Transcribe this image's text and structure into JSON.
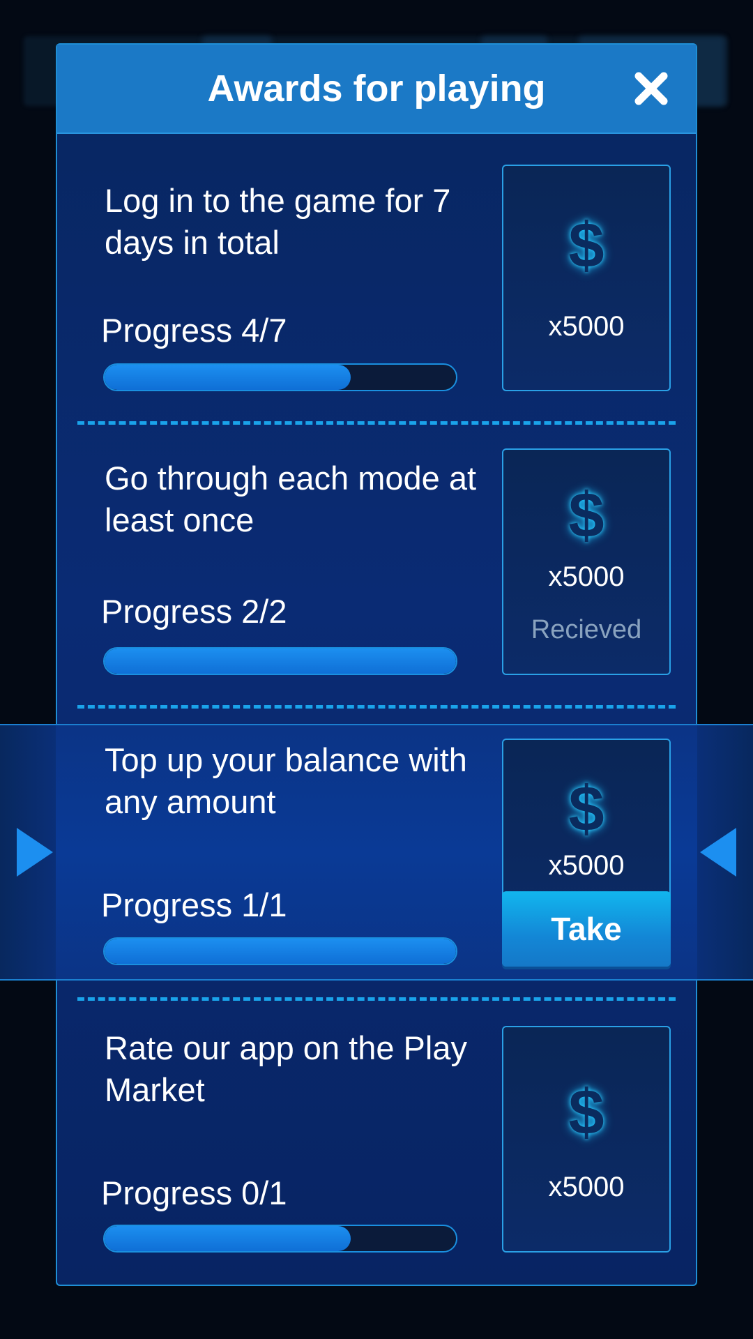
{
  "modal": {
    "title": "Awards for playing"
  },
  "tasks": [
    {
      "title": "Log in to the game for 7 days in total",
      "progress_label": "Progress 4/7",
      "progress_fraction": 0.7,
      "reward_amount": "x5000",
      "status": ""
    },
    {
      "title": "Go through each mode at least once",
      "progress_label": "Progress 2/2",
      "progress_fraction": 1.0,
      "reward_amount": "x5000",
      "status": "Recieved"
    },
    {
      "title": "Top up your balance with any amount",
      "progress_label": "Progress 1/1",
      "progress_fraction": 1.0,
      "reward_amount": "x5000",
      "action_label": "Take"
    },
    {
      "title": "Rate our app on the Play Market",
      "progress_label": "Progress 0/1",
      "progress_fraction": 0.7,
      "reward_amount": "x5000",
      "status": ""
    }
  ],
  "icons": {
    "reward": "dollar-icon",
    "close": "close-icon",
    "left_arrow": "arrow-right-icon",
    "right_arrow": "arrow-left-icon"
  },
  "colors": {
    "accent": "#1b79c6",
    "progress_fill": "#1c8ff0",
    "take_button": "#12b6ee",
    "received_text": "#8aa3bf"
  }
}
